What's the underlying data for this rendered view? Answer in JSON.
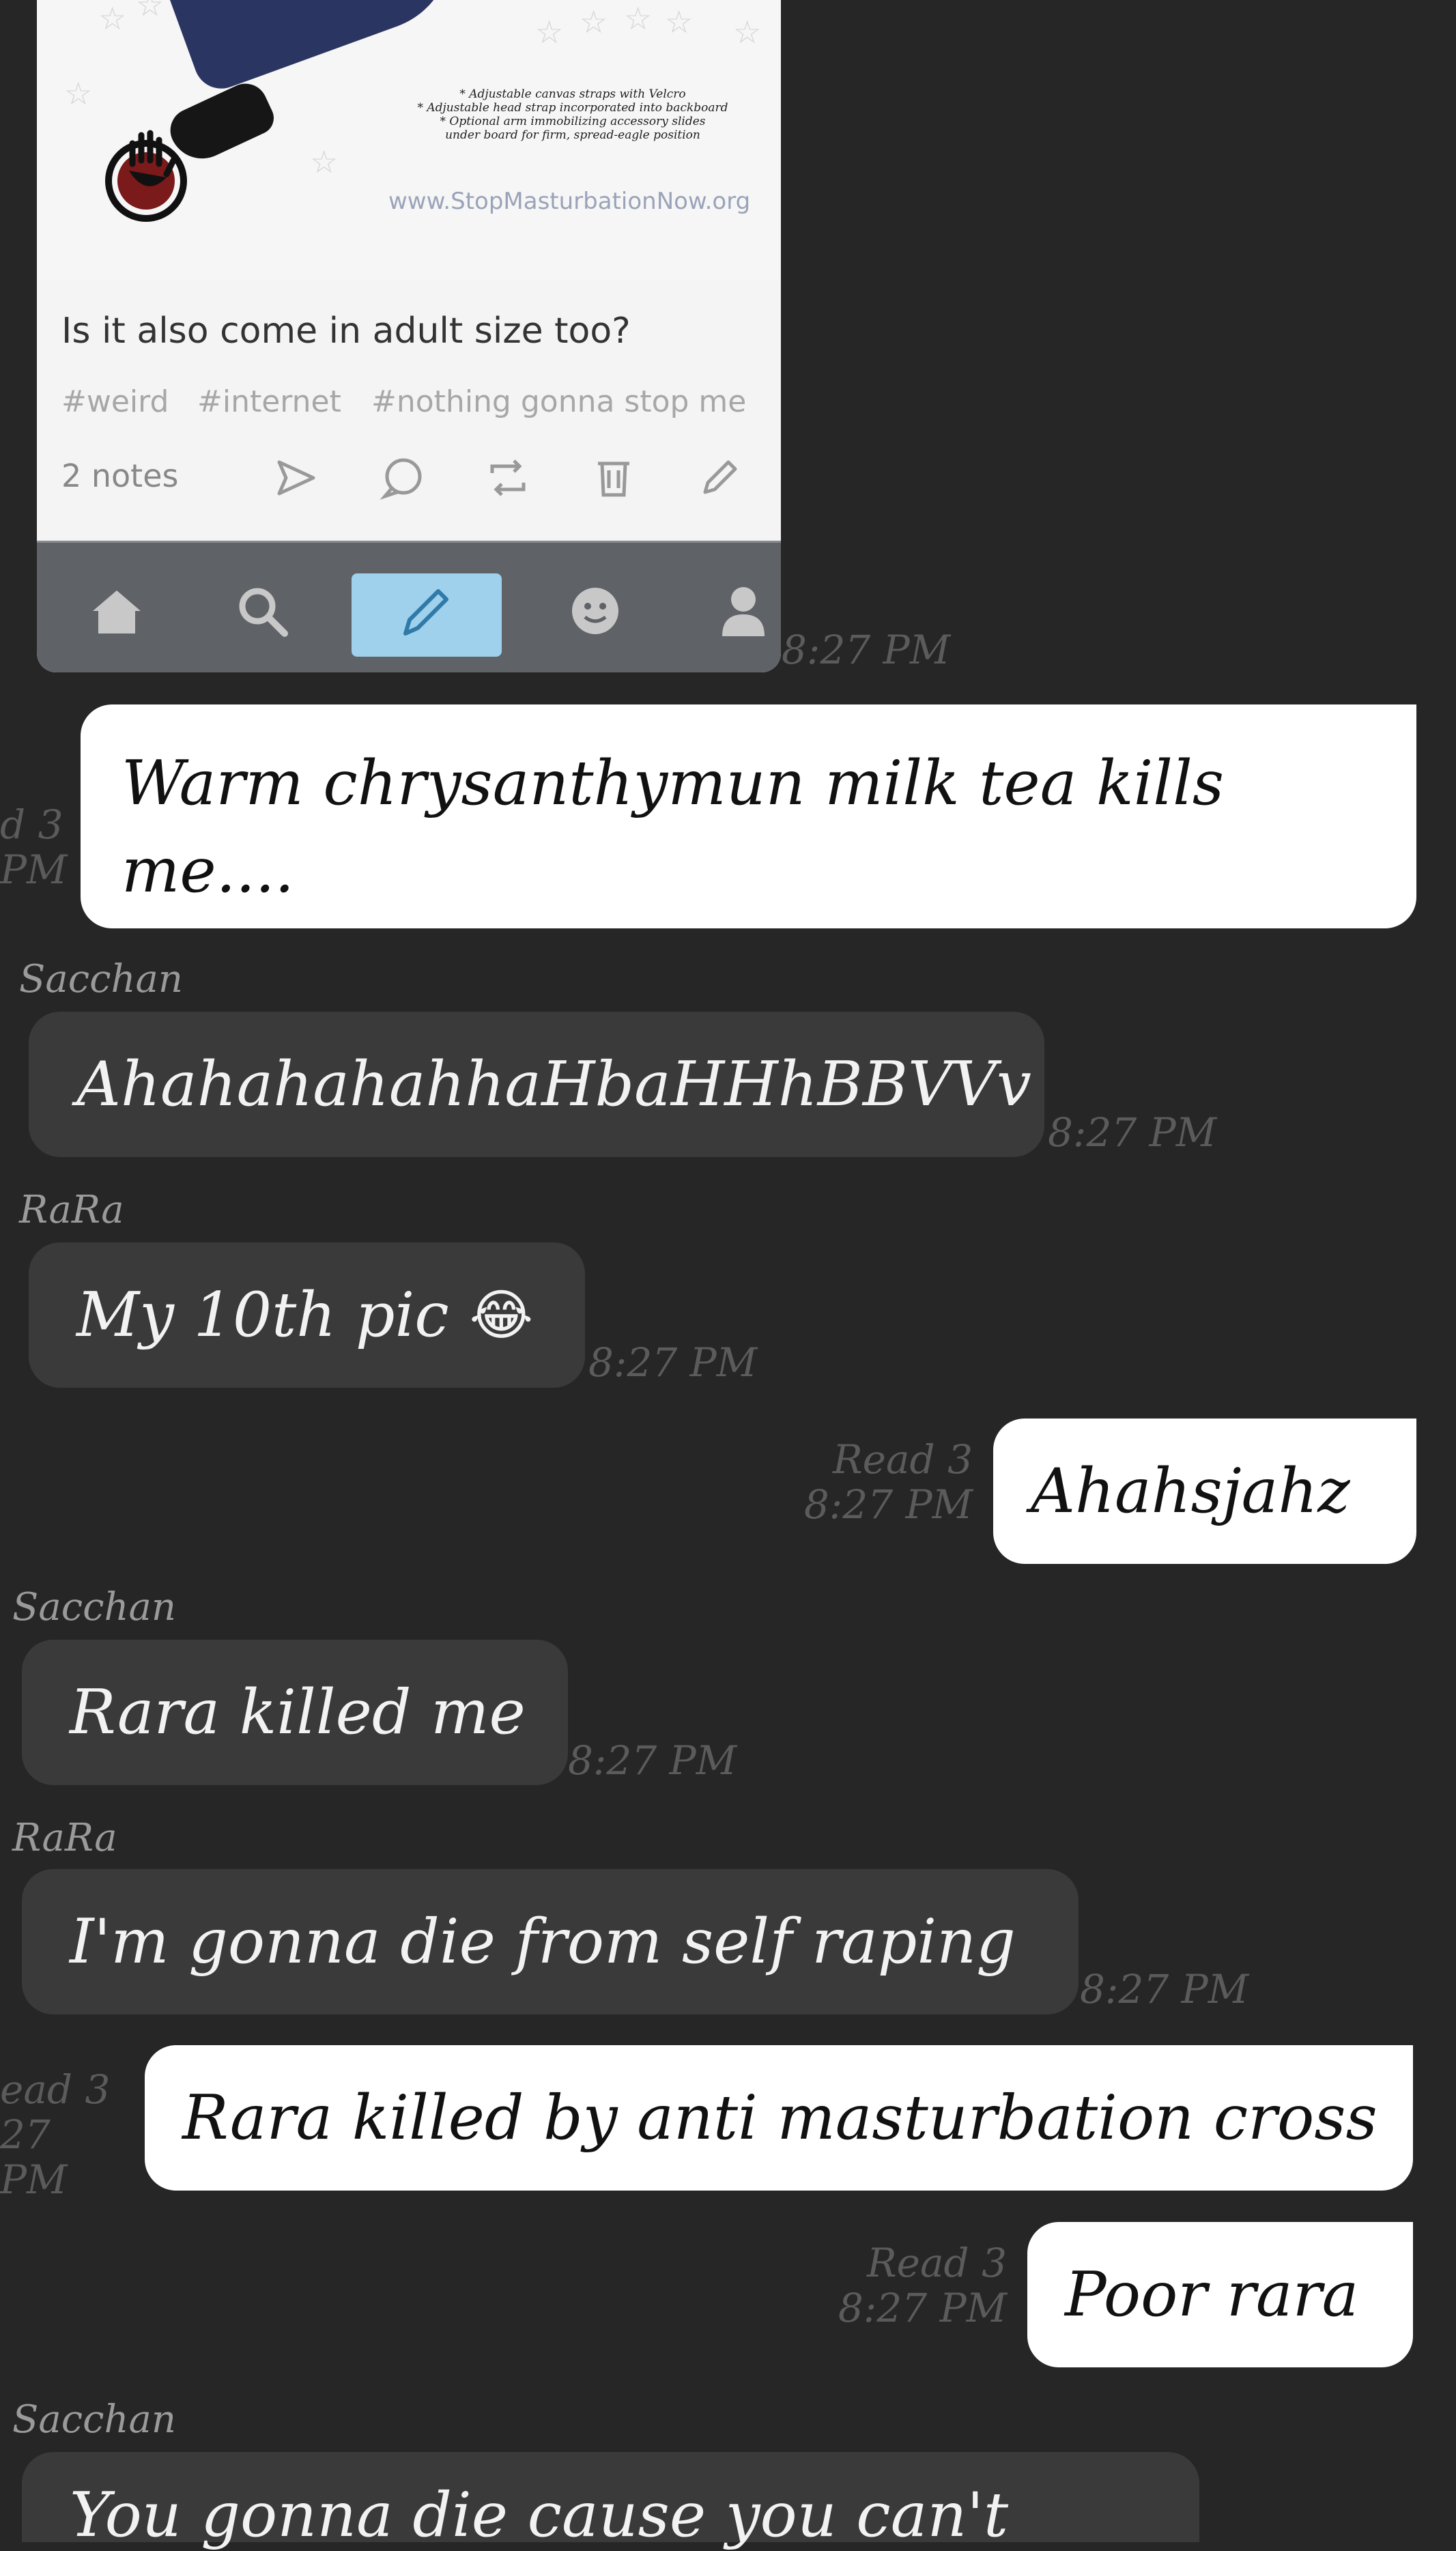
{
  "embedded_screenshot": {
    "caption_lines": [
      "* Adjustable canvas straps with Velcro",
      "* Adjustable head strap incorporated into backboard",
      "* Optional arm immobilizing accessory slides",
      "under board for firm, spread-eagle position"
    ],
    "site": "www.StopMasturbationNow.org",
    "post_text": "Is it also come in adult size too?",
    "tags": [
      "#weird",
      "#internet",
      "#nothing gonna stop me"
    ],
    "notes": "2 notes",
    "accent": "#9fd1ec"
  },
  "messages": [
    {
      "time": "8:27 PM"
    },
    {
      "text": "Warm chrysanthymun milk tea kills me....",
      "line1": "Warm chrysanthymun milk tea kills",
      "line2": "me....",
      "status": "d 3",
      "time": "PM"
    },
    {
      "sender": "Sacchan",
      "text": "AhahahahahhaHbaHHhBBVVv",
      "time": "8:27 PM"
    },
    {
      "sender": "RaRa",
      "text": "My 10th pic",
      "emoji": "😂",
      "time": "8:27 PM"
    },
    {
      "text": "Ahahsjahz",
      "status": "Read 3",
      "time": "8:27 PM"
    },
    {
      "sender": "Sacchan",
      "text": "Rara killed me",
      "time": "8:27 PM"
    },
    {
      "sender": "RaRa",
      "text": "I'm gonna die from self raping",
      "time": "8:27 PM"
    },
    {
      "text": "Rara killed by anti masturbation cross",
      "status": "ead 3",
      "time": "27 PM"
    },
    {
      "text": "Poor rara",
      "status": "Read 3",
      "time": "8:27 PM"
    },
    {
      "sender": "Sacchan",
      "text": "You gonna die cause you can't"
    }
  ]
}
